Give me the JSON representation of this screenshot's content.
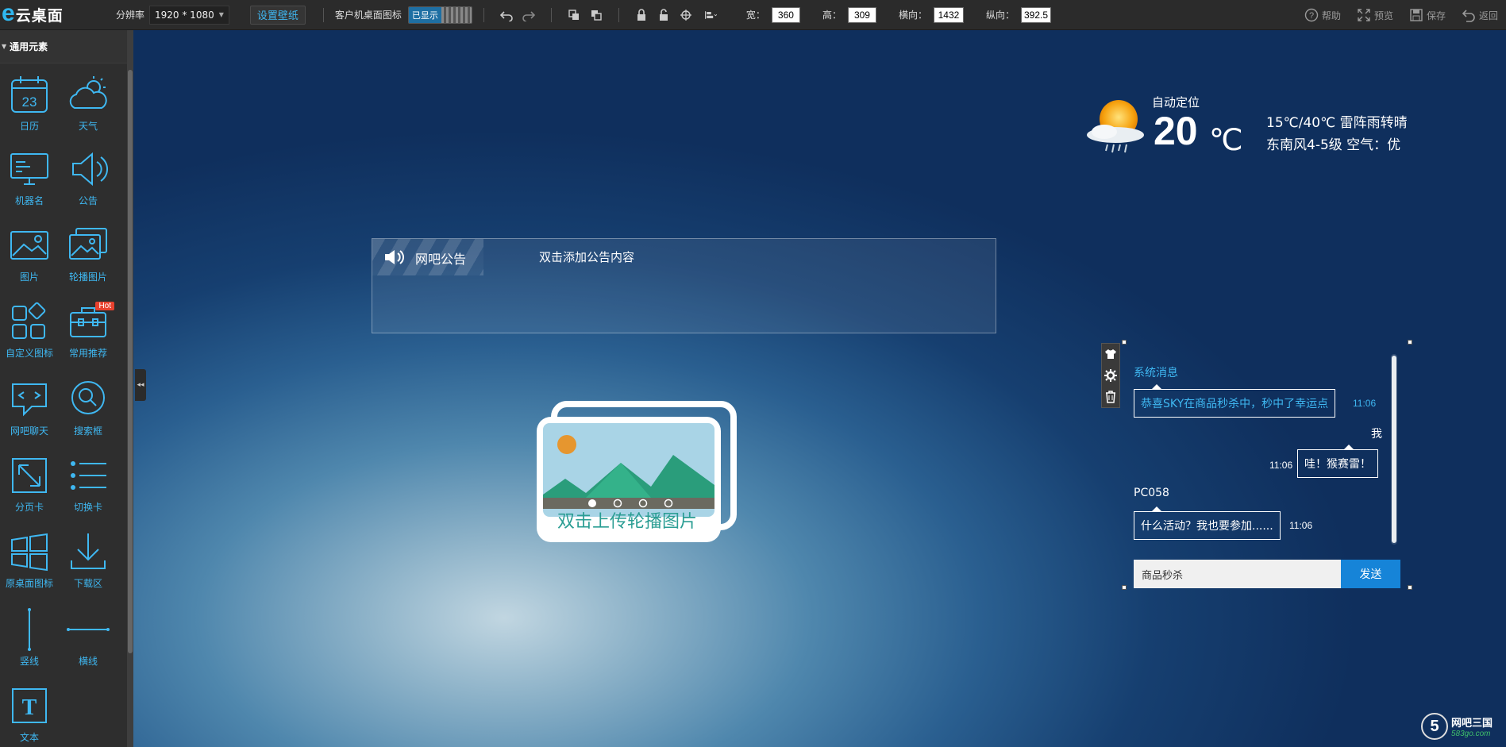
{
  "app": {
    "logo_mark": "e",
    "logo_text": "云桌面"
  },
  "toolbar": {
    "resolution_label": "分辨率",
    "resolution_value": "1920 * 1080",
    "set_wallpaper": "设置壁纸",
    "client_icons_label": "客户机桌面图标",
    "client_icons_state": "已显示",
    "width_label": "宽：",
    "width_value": "360",
    "height_label": "高：",
    "height_value": "309",
    "x_label": "横向：",
    "x_value": "1432",
    "y_label": "纵向：",
    "y_value": "392.5",
    "help": "帮助",
    "preview": "预览",
    "save": "保存",
    "back": "返回"
  },
  "sidebar": {
    "section": "通用元素",
    "tools": [
      {
        "label": "日历",
        "icon": "calendar-icon",
        "day": "23"
      },
      {
        "label": "天气",
        "icon": "weather-icon"
      },
      {
        "label": "机器名",
        "icon": "monitor-icon"
      },
      {
        "label": "公告",
        "icon": "speaker-icon"
      },
      {
        "label": "图片",
        "icon": "image-icon"
      },
      {
        "label": "轮播图片",
        "icon": "carousel-icon"
      },
      {
        "label": "自定义图标",
        "icon": "custom-icons-icon"
      },
      {
        "label": "常用推荐",
        "icon": "toolbox-icon",
        "badge": "Hot"
      },
      {
        "label": "网吧聊天",
        "icon": "chat-icon"
      },
      {
        "label": "搜索框",
        "icon": "search-icon"
      },
      {
        "label": "分页卡",
        "icon": "resize-icon"
      },
      {
        "label": "切换卡",
        "icon": "list-icon"
      },
      {
        "label": "原桌面图标",
        "icon": "windows-icon"
      },
      {
        "label": "下载区",
        "icon": "download-icon"
      },
      {
        "label": "竖线",
        "icon": "vertical-line-icon"
      },
      {
        "label": "横线",
        "icon": "horizontal-line-icon"
      },
      {
        "label": "文本",
        "icon": "text-icon",
        "glyph": "T"
      }
    ]
  },
  "weather": {
    "location": "自动定位",
    "temperature": "20",
    "unit": "℃",
    "range": "15℃/40℃ 雷阵雨转晴",
    "wind": "东南风4-5级 空气：优"
  },
  "notice": {
    "title": "网吧公告",
    "body": "双击添加公告内容"
  },
  "carousel": {
    "label": "双击上传轮播图片"
  },
  "chat": {
    "messages": [
      {
        "sender": "系统消息",
        "text": "恭喜SKY在商品秒杀中，秒中了幸运点",
        "time": "11:06",
        "side": "left",
        "color": "#3fb8f2"
      },
      {
        "sender": "我",
        "text": "哇！猴赛雷！",
        "time": "11:06",
        "side": "right",
        "color": "#ffffff"
      },
      {
        "sender": "PC058",
        "text": "什么活动？我也要参加......",
        "time": "11:06",
        "side": "left",
        "color": "#ffffff"
      }
    ],
    "input_value": "商品秒杀",
    "send_label": "发送"
  },
  "watermark": {
    "mark": "5",
    "title": "网吧三国",
    "url": "583go.com"
  },
  "colors": {
    "accent": "#3fb8f2",
    "send": "#1684d8",
    "hot": "#e8412e",
    "toolbar": "#2b2b2b"
  }
}
